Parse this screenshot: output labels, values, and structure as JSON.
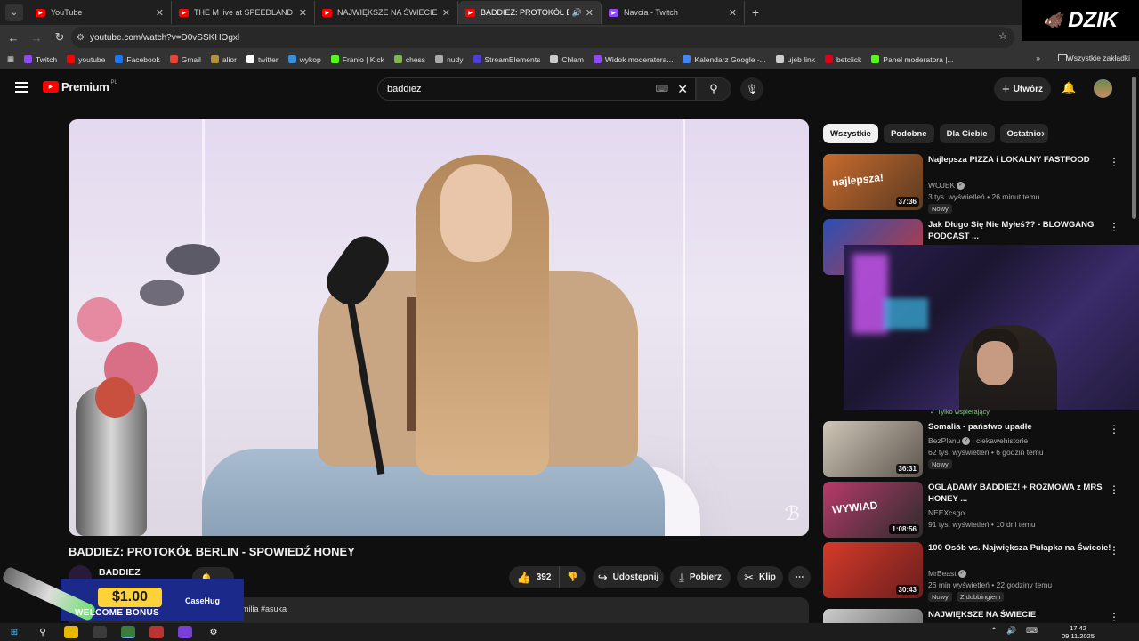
{
  "browser": {
    "tabs": [
      {
        "title": "YouTube",
        "favicon_color": "#ff0000",
        "active": false
      },
      {
        "title": "THE M live at SPEEDLAND FEST",
        "favicon_color": "#ff0000",
        "active": false
      },
      {
        "title": "NAJWIĘKSZE NA ŚWIECIE ZAW",
        "favicon_color": "#ff0000",
        "active": false
      },
      {
        "title": "BADDIEZ: PROTOKÓŁ BERLI",
        "favicon_color": "#ff0000",
        "active": true
      },
      {
        "title": "Navcia - Twitch",
        "favicon_color": "#9146ff",
        "active": false
      }
    ],
    "url": "youtube.com/watch?v=D0vSSKHOgxl",
    "bookmarks": [
      {
        "label": "Twitch",
        "color": "#9146ff"
      },
      {
        "label": "youtube",
        "color": "#ff0000"
      },
      {
        "label": "Facebook",
        "color": "#1877f2"
      },
      {
        "label": "Gmail",
        "color": "#ea4335"
      },
      {
        "label": "alior",
        "color": "#b5923a"
      },
      {
        "label": "twitter",
        "color": "#ffffff"
      },
      {
        "label": "wykop",
        "color": "#3b8fd6"
      },
      {
        "label": "Franio | Kick",
        "color": "#53fc18"
      },
      {
        "label": "chess",
        "color": "#81b64c"
      },
      {
        "label": "nudy",
        "color": "#aaaaaa"
      },
      {
        "label": "StreamElements",
        "color": "#4b3fd6"
      },
      {
        "label": "Chłam",
        "color": "#cccccc"
      },
      {
        "label": "Widok moderatora...",
        "color": "#9146ff"
      },
      {
        "label": "Kalendarz Google -...",
        "color": "#4285f4"
      },
      {
        "label": "ujeb link",
        "color": "#cccccc"
      },
      {
        "label": "betclick",
        "color": "#e10019"
      },
      {
        "label": "Panel moderatora |...",
        "color": "#53fc18"
      }
    ],
    "all_bookmarks_label": "Wszystkie zakładki"
  },
  "overlay_logo": "DZIK",
  "youtube": {
    "logo_text": "Premium",
    "logo_badge": "PL",
    "search_value": "baddiez",
    "create_label": "Utwórz",
    "video": {
      "title": "BADDIEZ: PROTOKÓŁ BERLIN - SPOWIEDŹ HONEY",
      "channel": "BADDIEZ",
      "likes": "392",
      "share_label": "Udostępnij",
      "download_label": "Pobierz",
      "clip_label": "Klip",
      "desc_snippet": "emilia #asuka"
    },
    "chips": [
      "Wszystkie",
      "Podobne",
      "Dla Ciebie",
      "Ostatnio"
    ],
    "recommendations": [
      {
        "title": "Najlepsza PIZZA i LOKALNY FASTFOOD",
        "channel": "WOJEK",
        "verified": true,
        "meta": "3 tys. wyświetleń • 26 minut temu",
        "badge": "Nowy",
        "duration": "37:36",
        "thumb_colors": [
          "#c96b2c",
          "#5a3a22"
        ],
        "thumb_text": "najlepsza!"
      },
      {
        "title": "Jak Długo Się Nie Myłeś?? - BLOWGANG PODCAST ...",
        "channel": "",
        "verified": false,
        "meta": "",
        "badge": "",
        "duration": "",
        "thumb_colors": [
          "#2a4fb6",
          "#c23a3a"
        ],
        "thumb_text": ""
      },
      {
        "title": "Somalia - państwo upadłe",
        "channel": "BezPlanu",
        "verified": true,
        "channel_extra": "i ciekawehistorie",
        "meta": "62 tys. wyświetleń • 6 godzin temu",
        "badge": "Nowy",
        "duration": "36:31",
        "thumb_colors": [
          "#cfc6b7",
          "#5d564e"
        ],
        "thumb_text": ""
      },
      {
        "title": "OGLĄDAMY BADDIEZ! + ROZMOWA z MRS HONEY ...",
        "channel": "NEEXcsgo",
        "verified": false,
        "meta": "91 tys. wyświetleń • 10 dni temu",
        "badge": "",
        "duration": "1:08:56",
        "thumb_colors": [
          "#b83a6a",
          "#2c2c2c"
        ],
        "thumb_text": "WYWIAD"
      },
      {
        "title": "100 Osób vs. Największa Pułapka na Świecie!",
        "channel": "MrBeast",
        "verified": true,
        "meta": "26 min wyświetleń • 22 godziny temu",
        "badge": "Nowy",
        "badge2": "Z dubbingiem",
        "duration": "30:43",
        "thumb_colors": [
          "#d63a2a",
          "#6a1e1e"
        ],
        "thumb_text": ""
      },
      {
        "title": "NAJWIĘKSZE NA ŚWIECIE",
        "channel": "",
        "verified": false,
        "meta": "",
        "badge": "",
        "duration": "",
        "thumb_colors": [
          "#cccccc",
          "#555555"
        ],
        "thumb_text": "WNBE"
      }
    ],
    "support_text": "Tylko wspierający"
  },
  "ad": {
    "amount": "$1.00",
    "bonus": "WELCOME BONUS",
    "brand": "CaseHug"
  },
  "taskbar": {
    "time": "17:42",
    "date": "09.11.2025"
  }
}
